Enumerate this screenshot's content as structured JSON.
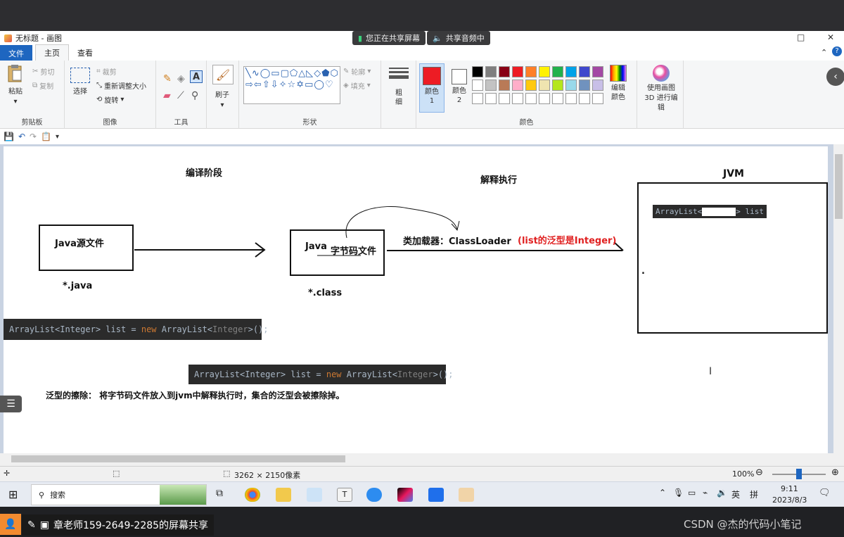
{
  "share": {
    "screen_label": "您正在共享屏幕",
    "audio_label": "共享音频中"
  },
  "window": {
    "title": "无标题 - 画图"
  },
  "tabs": {
    "file": "文件",
    "home": "主页",
    "view": "查看"
  },
  "ribbon": {
    "clipboard": {
      "paste": "粘贴",
      "cut": "剪切",
      "copy": "复制",
      "label": "剪贴板"
    },
    "image": {
      "select": "选择",
      "crop": "裁剪",
      "resize": "重新调整大小",
      "rotate": "旋转",
      "label": "图像"
    },
    "tools": {
      "label": "工具"
    },
    "brushes": {
      "label": "刷子"
    },
    "shapes": {
      "outline": "轮廓",
      "fill": "填充",
      "label": "形状"
    },
    "size": {
      "label": "粗细"
    },
    "colors": {
      "color1": "颜色 1",
      "color2": "颜色 2",
      "edit": "编辑颜色",
      "label": "颜色",
      "paint3d": "使用画图 3D 进行编辑"
    },
    "palette_row1": [
      "#000000",
      "#7f7f7f",
      "#880015",
      "#ed1c24",
      "#ff7f27",
      "#fff200",
      "#22b14c",
      "#00a2e8",
      "#3f48cc",
      "#a349a4"
    ],
    "palette_row2": [
      "#ffffff",
      "#c3c3c3",
      "#b97a57",
      "#ffaec9",
      "#ffc90e",
      "#efe4b0",
      "#b5e61d",
      "#99d9ea",
      "#7092be",
      "#c8bfe7"
    ],
    "color1_value": "#ed1c24",
    "color2_value": "#ffffff"
  },
  "canvas": {
    "compile_stage": "编译阶段",
    "interpret_exec": "解释执行",
    "jvm": "JVM",
    "java_source": "Java源文件",
    "java_ext": "*.java",
    "java_bytecode_prefix": "Java",
    "bytecode": "字节码文件",
    "class_ext": "*.class",
    "classloader_label": "类加载器：ClassLoader",
    "generic_note": "(list的泛型是Integer)",
    "jvm_code_left": "ArrayList<",
    "jvm_code_right": "> list",
    "jvm_dot": ".",
    "code1_a": "ArrayList<Integer> list = ",
    "code1_kw": "new",
    "code1_b": " ArrayList<",
    "code1_gen": "Integer",
    "code1_c": ">();",
    "code2_a": "ArrayList<Integer> list = ",
    "code2_kw": "new",
    "code2_b": " ArrayList<",
    "code2_gen": "Integer",
    "code2_c": ">();",
    "erasure": "泛型的擦除： 将字节码文件放入到jvm中解释执行时，集合的泛型会被擦除掉。"
  },
  "status": {
    "size": "3262 × 2150像素",
    "zoom": "100%"
  },
  "taskbar": {
    "search": "搜索",
    "time": "9:11",
    "date": "2023/8/3",
    "lang": "英",
    "ime": "拼"
  },
  "bottom": {
    "sharing": "章老师159-2649-2285的屏幕共享",
    "watermark": "CSDN @杰的代码小笔记"
  }
}
